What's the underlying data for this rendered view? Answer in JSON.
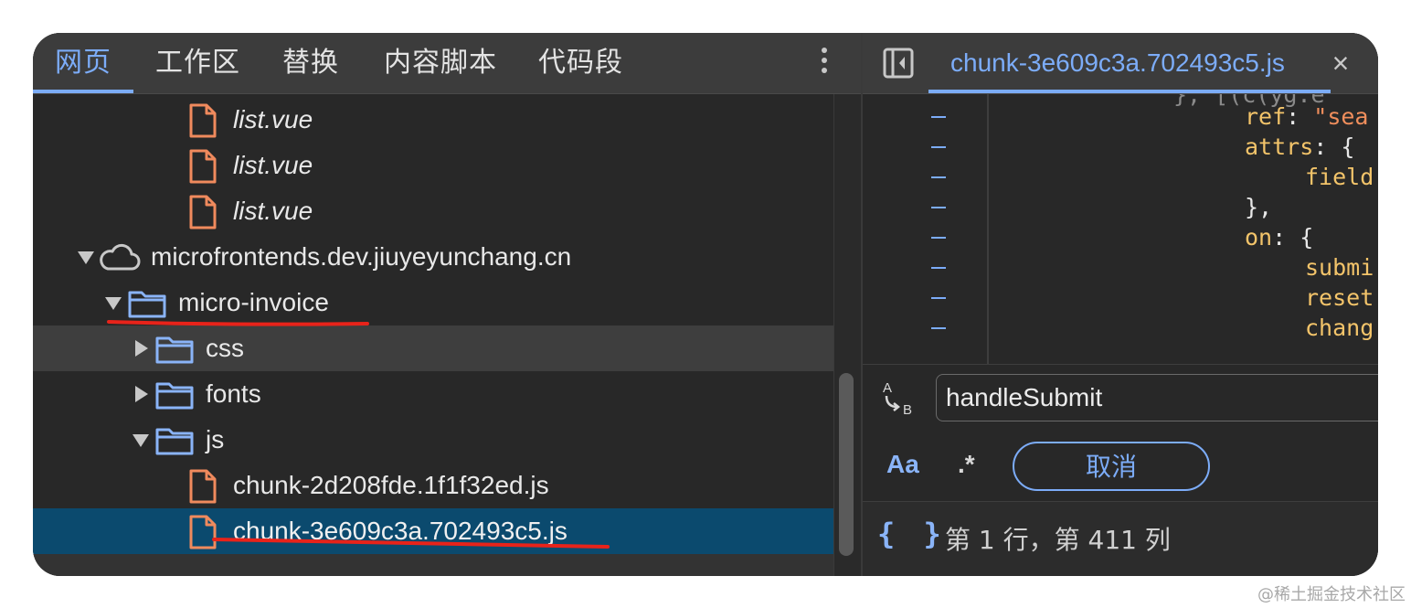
{
  "navigator": {
    "tabs": [
      {
        "label": "网页"
      },
      {
        "label": "工作区"
      },
      {
        "label": "替换"
      },
      {
        "label": "内容脚本"
      },
      {
        "label": "代码段"
      }
    ],
    "active_tab": "网页",
    "tree": [
      {
        "label": "list.vue",
        "kind": "file"
      },
      {
        "label": "list.vue",
        "kind": "file"
      },
      {
        "label": "list.vue",
        "kind": "file"
      },
      {
        "label": "microfrontends.dev.jiuyeyunchang.cn",
        "kind": "domain",
        "expanded": true
      },
      {
        "label": "micro-invoice",
        "kind": "folder",
        "expanded": true
      },
      {
        "label": "css",
        "kind": "folder",
        "expanded": false
      },
      {
        "label": "fonts",
        "kind": "folder",
        "expanded": false
      },
      {
        "label": "js",
        "kind": "folder",
        "expanded": true
      },
      {
        "label": "chunk-2d208fde.1f1f32ed.js",
        "kind": "file"
      },
      {
        "label": "chunk-3e609c3a.702493c5.js",
        "kind": "file",
        "selected": true
      }
    ]
  },
  "editor": {
    "open_file": "chunk-3e609c3a.702493c5.js",
    "code_lines": [
      {
        "prefix": "ref",
        "punct": ": ",
        "value": "\"sea"
      },
      {
        "prefix": "attrs",
        "punct": ": {",
        "value": ""
      },
      {
        "prefix": "field",
        "punct": "",
        "value": ""
      },
      {
        "prefix": "",
        "punct": "},",
        "value": ""
      },
      {
        "prefix": "on",
        "punct": ": {",
        "value": ""
      },
      {
        "prefix": "submi",
        "punct": "",
        "value": ""
      },
      {
        "prefix": "reset",
        "punct": "",
        "value": ""
      },
      {
        "prefix": "chang",
        "punct": "",
        "value": ""
      }
    ]
  },
  "search": {
    "query": "handleSubmit",
    "match_case_label": "Aa",
    "regex_label": ".*",
    "cancel_label": "取消"
  },
  "status": {
    "braces_label": "{ }",
    "position_text": "第 1 行，第 411 列"
  },
  "watermark": "@稀土掘金技术社区",
  "colors": {
    "accent": "#7cacf8",
    "selected_row": "#0b4a6e",
    "file_icon": "#f08a5d",
    "folder_icon": "#8ab4f8",
    "annotation_red": "#e8231a"
  }
}
